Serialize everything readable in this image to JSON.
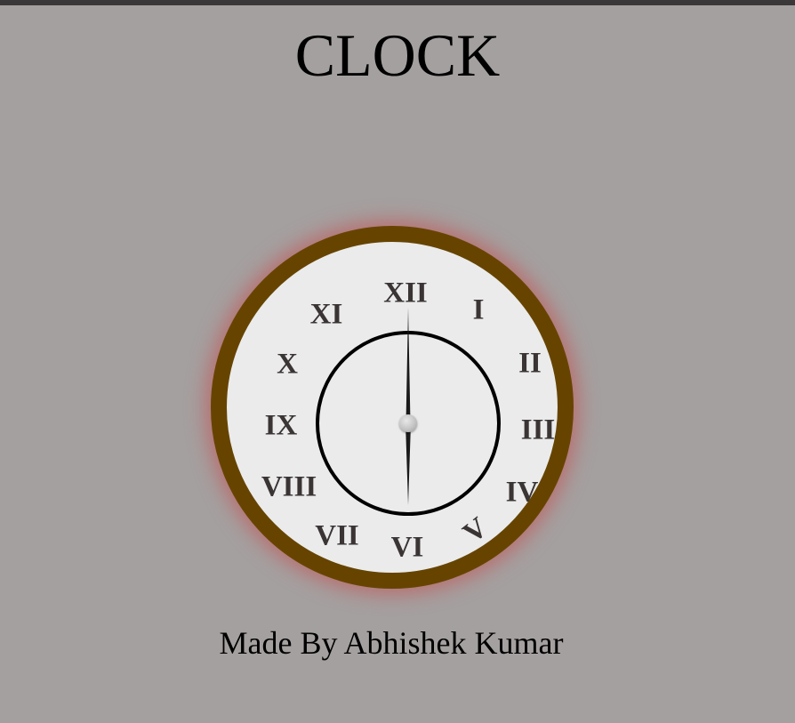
{
  "page": {
    "title": "CLOCK",
    "credit": "Made By Abhishek Kumar"
  },
  "clock": {
    "numerals": [
      "XII",
      "I",
      "II",
      "III",
      "IV",
      "V",
      "VI",
      "VII",
      "VIII",
      "IX",
      "X",
      "XI"
    ],
    "time_shown": "6:00"
  },
  "colors": {
    "background": "#a5a0a0",
    "clock_rim": "#664400",
    "clock_face": "#ebebeb",
    "glow": "#c84646",
    "numerals": "#3a3434"
  }
}
